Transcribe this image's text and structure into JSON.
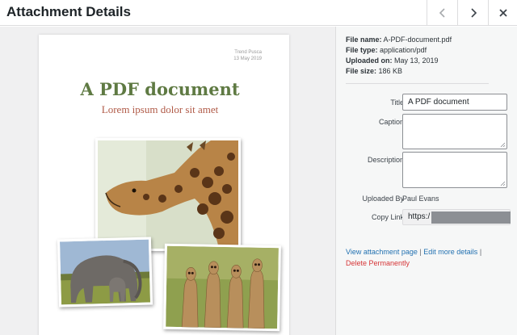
{
  "header": {
    "title": "Attachment Details",
    "prev_icon": "chevron-left-icon",
    "next_icon": "chevron-right-icon",
    "close_icon": "close-icon"
  },
  "preview": {
    "author_name": "Trend Pusca",
    "author_date": "13 May 2019",
    "title": "A PDF document",
    "subtitle": "Lorem ipsum dolor sit amet",
    "images": [
      "giraffe photo",
      "elephant photo",
      "meerkats photo"
    ]
  },
  "details": {
    "file_name_label": "File name:",
    "file_name": "A-PDF-document.pdf",
    "file_type_label": "File type:",
    "file_type": "application/pdf",
    "uploaded_on_label": "Uploaded on:",
    "uploaded_on": "May 13, 2019",
    "file_size_label": "File size:",
    "file_size": "186 KB"
  },
  "fields": {
    "title_label": "Title",
    "title_value": "A PDF document",
    "caption_label": "Caption",
    "caption_value": "",
    "description_label": "Description",
    "description_value": "",
    "uploaded_by_label": "Uploaded By",
    "uploaded_by_value": "Paul Evans",
    "copy_link_label": "Copy Link",
    "copy_link_value": "https:/"
  },
  "actions": {
    "view_page": "View attachment page",
    "separator": "|",
    "edit_details": "Edit more details",
    "delete": "Delete Permanently"
  },
  "colors": {
    "link": "#2271b1",
    "delete": "#d63638",
    "pdf_title": "#5f7a43",
    "pdf_subtitle": "#b05a47"
  }
}
